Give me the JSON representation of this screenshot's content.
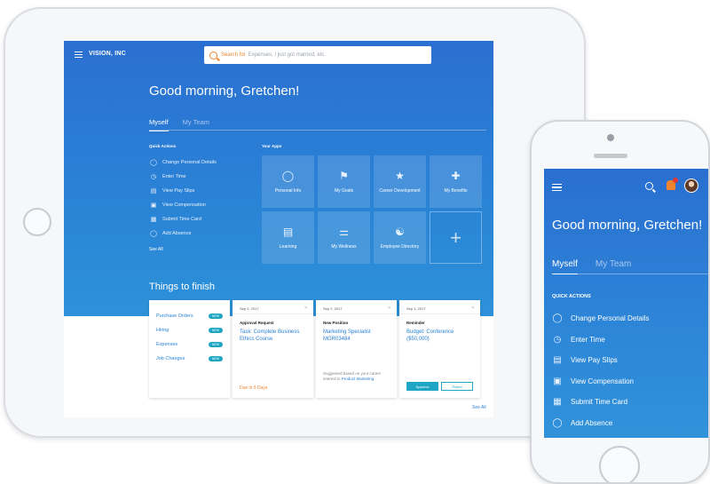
{
  "tablet": {
    "brand": "VISION, INC",
    "search": {
      "label": "Search for",
      "placeholder": "Expenses, I just got married, etc."
    },
    "greeting": "Good morning, Gretchen!",
    "tabs": [
      {
        "label": "Myself"
      },
      {
        "label": "My Team"
      }
    ],
    "quick_actions": {
      "title": "Quick Actions",
      "items": [
        {
          "label": "Change Personal Details",
          "icon": "person-icon"
        },
        {
          "label": "Enter Time",
          "icon": "clock-icon"
        },
        {
          "label": "View Pay Slips",
          "icon": "document-icon"
        },
        {
          "label": "View Compensation",
          "icon": "money-icon"
        },
        {
          "label": "Submit Time Card",
          "icon": "timecard-icon"
        },
        {
          "label": "Add Absence",
          "icon": "person-icon"
        }
      ],
      "see_all": "See All"
    },
    "apps": {
      "title": "Your Apps",
      "items": [
        {
          "label": "Personal Info",
          "icon": "person-icon"
        },
        {
          "label": "My Goals",
          "icon": "flag-icon"
        },
        {
          "label": "Career Development",
          "icon": "career-icon"
        },
        {
          "label": "My Benefits",
          "icon": "plus-cross-icon"
        },
        {
          "label": "Learning",
          "icon": "book-icon"
        },
        {
          "label": "My Wellness",
          "icon": "dumbbell-icon"
        },
        {
          "label": "Employee Directory",
          "icon": "org-chart-icon"
        }
      ]
    },
    "things": {
      "title": "Things to finish",
      "finish_list": [
        {
          "label": "Purchase Orders",
          "badge": "NEW"
        },
        {
          "label": "Hiring",
          "badge": "NEW"
        },
        {
          "label": "Expenses",
          "badge": "NEW"
        },
        {
          "label": "Job Changes",
          "badge": "NEW"
        }
      ],
      "cards": [
        {
          "date": "Sep 2, 2017",
          "type": "Approval Request",
          "body": "Task: Complete Business Ethics Course",
          "due": "Due in 5 Days"
        },
        {
          "date": "Sep 2, 2017",
          "type": "New Position",
          "body": "Marketing Specialist MGR03484",
          "note": "Suggested based on your career interest in",
          "note_link": "Product Marketing"
        },
        {
          "date": "Sep 1, 2017",
          "type": "Reminder",
          "body": "Budget: Conference ($50,000)",
          "approve": "Approve",
          "reject": "Reject"
        }
      ],
      "see_all": "See All"
    }
  },
  "phone": {
    "greeting": "Good morning, Gretchen!",
    "tabs": [
      {
        "label": "Myself"
      },
      {
        "label": "My Team"
      }
    ],
    "quick_actions": {
      "title": "QUICK ACTIONS",
      "items": [
        {
          "label": "Change Personal Details",
          "icon": "person-icon"
        },
        {
          "label": "Enter Time",
          "icon": "clock-icon"
        },
        {
          "label": "View Pay Slips",
          "icon": "document-icon"
        },
        {
          "label": "View Compensation",
          "icon": "money-icon"
        },
        {
          "label": "Submit Time Card",
          "icon": "timecard-icon"
        },
        {
          "label": "Add Absence",
          "icon": "person-icon"
        }
      ]
    }
  },
  "colors": {
    "primary_blue": "#2a82d6",
    "accent_orange": "#f0852d",
    "teal": "#1fa6c5"
  }
}
